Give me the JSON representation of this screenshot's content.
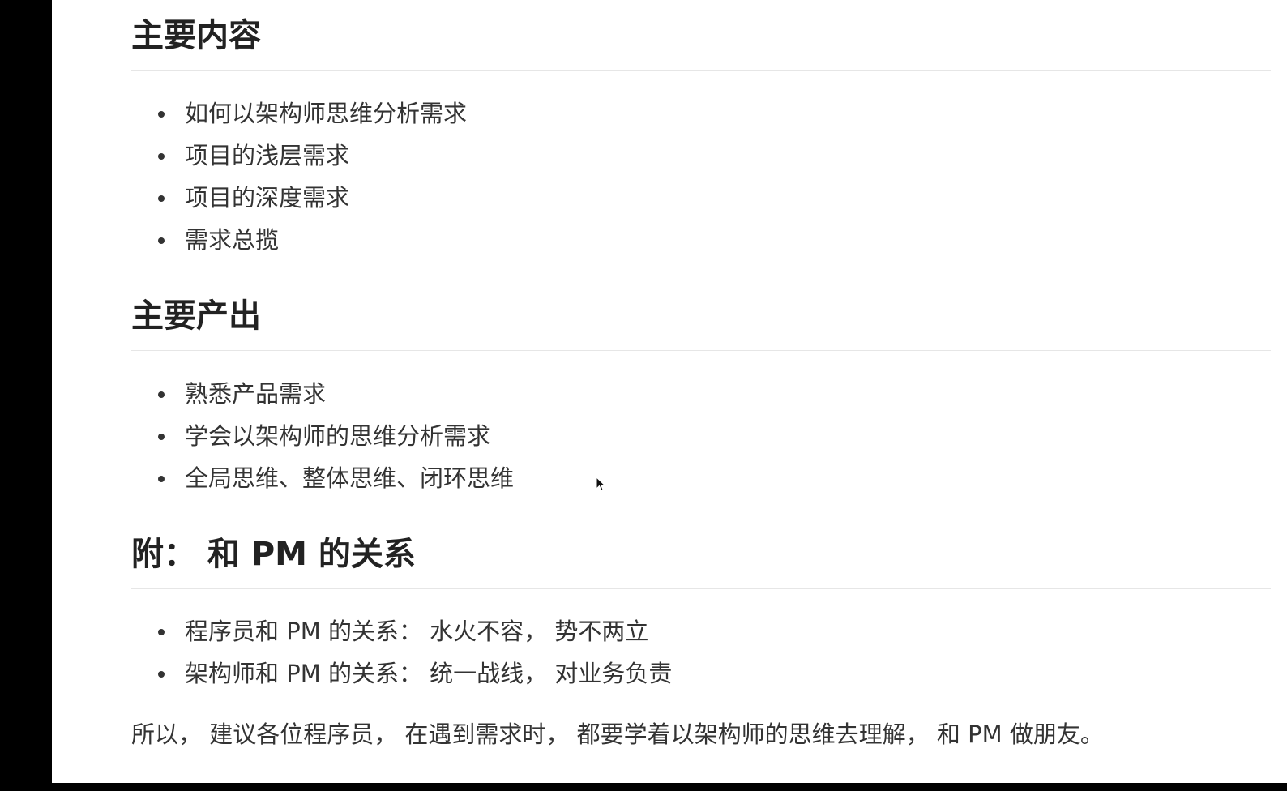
{
  "sections": [
    {
      "heading": "主要内容",
      "items": [
        "如何以架构师思维分析需求",
        "项目的浅层需求",
        "项目的深度需求",
        "需求总揽"
      ]
    },
    {
      "heading": "主要产出",
      "items": [
        "熟悉产品需求",
        "学会以架构师的思维分析需求",
        "全局思维、整体思维、闭环思维"
      ]
    },
    {
      "heading": "附： 和 PM 的关系",
      "items": [
        "程序员和 PM 的关系： 水火不容， 势不两立",
        "架构师和 PM 的关系： 统一战线， 对业务负责"
      ]
    }
  ],
  "closing": "所以， 建议各位程序员， 在遇到需求时， 都要学着以架构师的思维去理解， 和 PM 做朋友。",
  "colors": {
    "text": "#333333",
    "heading": "#222222",
    "rule": "#e6e6e6",
    "background": "#ffffff",
    "frame": "#000000"
  },
  "icons": {
    "cursor": "mouse-pointer-icon"
  }
}
